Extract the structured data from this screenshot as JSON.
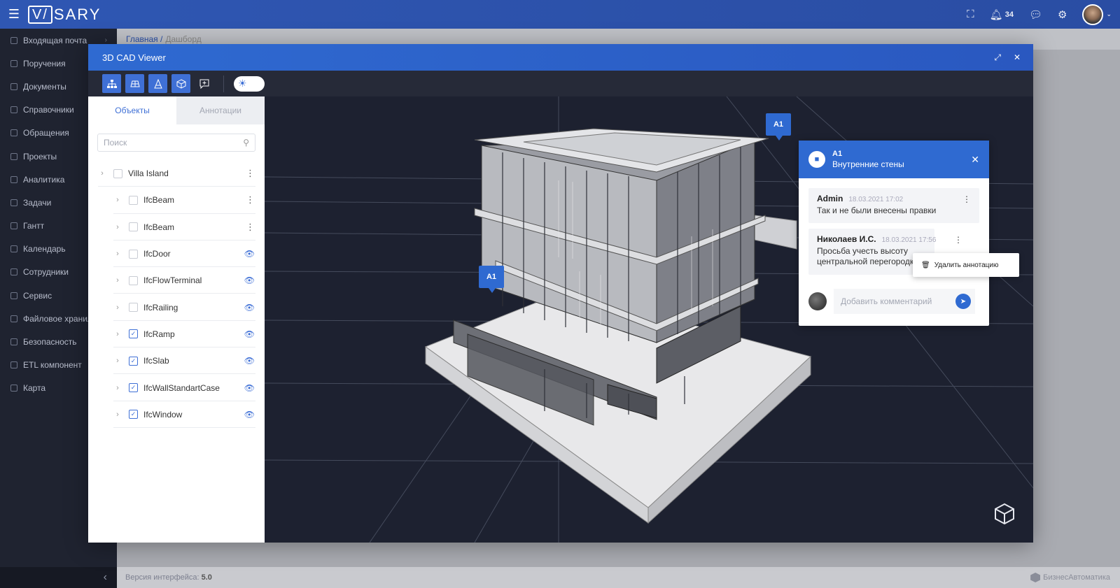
{
  "app": {
    "logo": "SARY",
    "logo_v": "V/"
  },
  "topbar": {
    "notif_count": "34"
  },
  "sidebar": {
    "items": [
      {
        "label": "Входящая почта",
        "has_arrow": true
      },
      {
        "label": "Поручения"
      },
      {
        "label": "Документы"
      },
      {
        "label": "Справочники"
      },
      {
        "label": "Обращения"
      },
      {
        "label": "Проекты"
      },
      {
        "label": "Аналитика"
      },
      {
        "label": "Задачи"
      },
      {
        "label": "Гантт"
      },
      {
        "label": "Календарь"
      },
      {
        "label": "Сотрудники"
      },
      {
        "label": "Сервис"
      },
      {
        "label": "Файловое хранил"
      },
      {
        "label": "Безопасность"
      },
      {
        "label": "ETL компонент"
      },
      {
        "label": "Карта"
      }
    ],
    "collapse_glyph": "‹"
  },
  "breadcrumb": {
    "home": "Главная /",
    "current": "Дашборд"
  },
  "footer": {
    "version_label": "Версия интерфейса:",
    "version": "5.0",
    "brand": "БизнесАвтоматика"
  },
  "modal": {
    "title": "3D CAD Viewer",
    "tabs": {
      "objects": "Объекты",
      "annotations": "Аннотации"
    },
    "search_placeholder": "Поиск",
    "tree": [
      {
        "label": "Villa Island",
        "level": 0,
        "checked": false,
        "action": "more"
      },
      {
        "label": "IfcBeam",
        "level": 1,
        "checked": false,
        "action": "more"
      },
      {
        "label": "IfcBeam",
        "level": 1,
        "checked": false,
        "action": "more"
      },
      {
        "label": "IfcDoor",
        "level": 1,
        "checked": false,
        "action": "eye"
      },
      {
        "label": "IfcFlowTerminal",
        "level": 1,
        "checked": false,
        "action": "eye"
      },
      {
        "label": "IfcRailing",
        "level": 1,
        "checked": false,
        "action": "eye"
      },
      {
        "label": "IfcRamp",
        "level": 1,
        "checked": true,
        "action": "eye"
      },
      {
        "label": "IfcSlab",
        "level": 1,
        "checked": true,
        "action": "eye"
      },
      {
        "label": "IfcWallStandartCase",
        "level": 1,
        "checked": true,
        "action": "eye"
      },
      {
        "label": "IfcWindow",
        "level": 1,
        "checked": true,
        "action": "eye"
      }
    ]
  },
  "annotation": {
    "marker_label": "A1",
    "id": "A1",
    "subtitle": "Внутренние стены",
    "comments": [
      {
        "author": "Admin",
        "date": "18.03.2021 17:02",
        "text": "Так и не были внесены правки"
      },
      {
        "author": "Николаев И.С.",
        "date": "18.03.2021 17:56",
        "text": "Просьба учесть высоту центральной перегородки"
      }
    ],
    "add_placeholder": "Добавить комментарий",
    "context_menu": "Удалить аннотацию"
  },
  "colors": {
    "accent": "#2f6ad1",
    "viewport_bg": "#1d2130",
    "sidebar_bg": "#1f2330"
  }
}
